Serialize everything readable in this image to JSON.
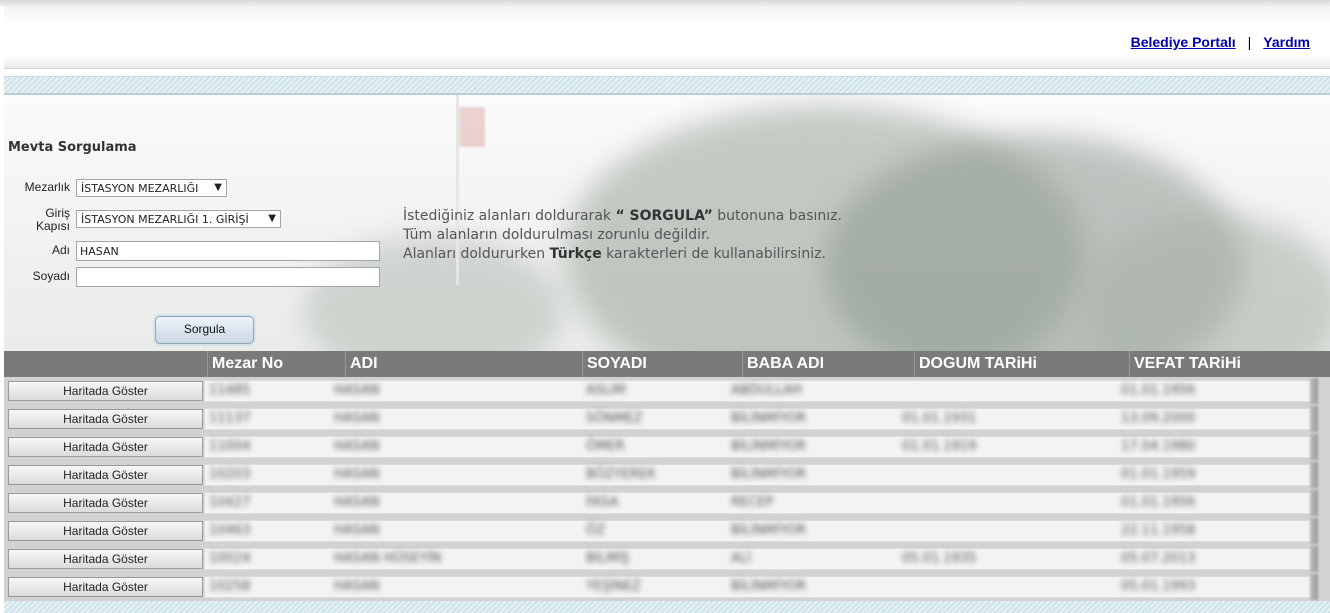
{
  "header": {
    "links": [
      "Belediye Portalı",
      "Yardım"
    ],
    "separator": "|"
  },
  "form": {
    "title": "Mevta Sorgulama",
    "mezarlik_label": "Mezarlık",
    "mezarlik_value": "İSTASYON MEZARLIĞI",
    "giris_label_1": "Giriş",
    "giris_label_2": "Kapısı",
    "giris_value": "İSTASYON MEZARLIĞI 1. GİRİŞİ",
    "adi_label": "Adı",
    "adi_value": "HASAN",
    "soyadi_label": "Soyadı",
    "soyadi_value": "",
    "submit_label": "Sorgula"
  },
  "info": {
    "line1_prefix": "İstediğiniz alanları doldurarak ",
    "line1_bold": "“ SORGULA”",
    "line1_suffix": " butonuna basınız.",
    "line2": "Tüm alanların doldurulması zorunlu değildir.",
    "line3_prefix": "Alanları doldururken ",
    "line3_bold": "Türkçe",
    "line3_suffix": " karakterleri de kullanabilirsiniz."
  },
  "table": {
    "columns": [
      "Mezar No",
      "ADI",
      "SOYADI",
      "BABA ADI",
      "DOGUM TARiHi",
      "VEFAT TARiHi"
    ],
    "row_button_label": "Haritada Göster",
    "rows": [
      {
        "mezar_no": "11485",
        "adi": "HASAN",
        "soyadi": "ASLIM",
        "baba_adi": "ABDULLAH",
        "dogum": "",
        "vefat": "01.01.1956"
      },
      {
        "mezar_no": "11137",
        "adi": "HASAN",
        "soyadi": "SÖNMEZ",
        "baba_adi": "BİLİNMİYOR",
        "dogum": "01.01.1931",
        "vefat": "13.09.2000"
      },
      {
        "mezar_no": "11004",
        "adi": "HASAN",
        "soyadi": "ÖMER",
        "baba_adi": "BİLİNMİYOR",
        "dogum": "01.01.1919",
        "vefat": "17.04.1980"
      },
      {
        "mezar_no": "10203",
        "adi": "HASAN",
        "soyadi": "BÖZYEREK",
        "baba_adi": "BİLİNMİYOR",
        "dogum": "",
        "vefat": "01.01.1959"
      },
      {
        "mezar_no": "10427",
        "adi": "HASAN",
        "soyadi": "FASA",
        "baba_adi": "RECEP",
        "dogum": "",
        "vefat": "01.01.1956"
      },
      {
        "mezar_no": "10463",
        "adi": "HASAN",
        "soyadi": "ÖZ",
        "baba_adi": "BİLİNMİYOR",
        "dogum": "",
        "vefat": "22.11.1958"
      },
      {
        "mezar_no": "10024",
        "adi": "HASAN HÜSEYİN",
        "soyadi": "BİLMİŞ",
        "baba_adi": "ALİ",
        "dogum": "05.01.1935",
        "vefat": "05.07.2013"
      },
      {
        "mezar_no": "10258",
        "adi": "HASAN",
        "soyadi": "YEŞİNEZ",
        "baba_adi": "BİLİNMİYOR",
        "dogum": "",
        "vefat": "05.01.1993"
      }
    ]
  },
  "colors": {
    "link": "#0000aa",
    "table_header_bg": "#7a7a7a",
    "band": "#cfe3ea"
  }
}
